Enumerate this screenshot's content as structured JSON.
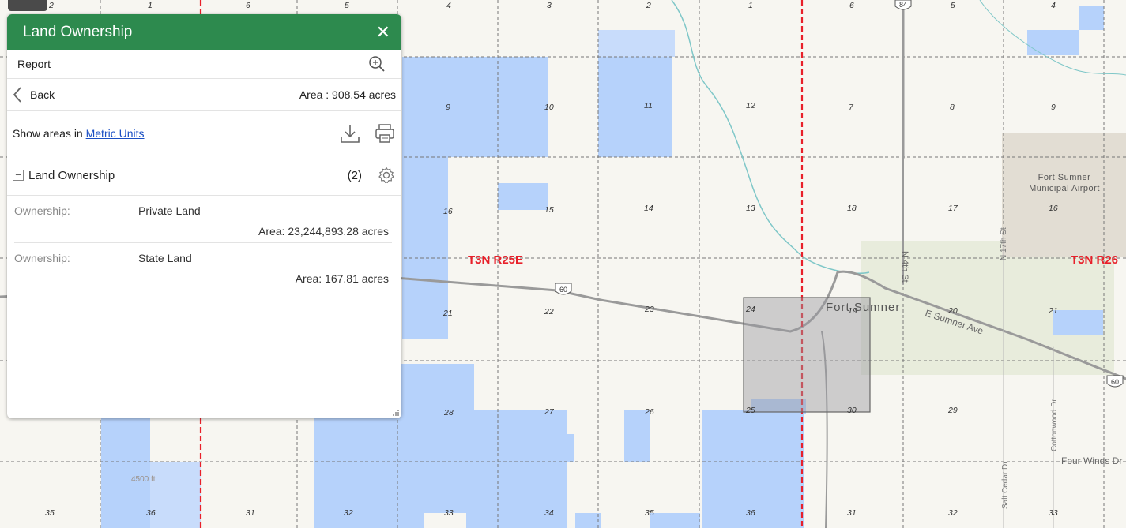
{
  "panel": {
    "title": "Land Ownership",
    "report_label": "Report",
    "back_label": "Back",
    "area_total": "Area : 908.54 acres",
    "show_areas_prefix": "Show areas in",
    "units_link": "Metric Units",
    "layer_name": "Land Ownership",
    "layer_count": "(2)",
    "results": [
      {
        "key": "Ownership:",
        "value": "Private Land",
        "area": "Area: 23,244,893.28 acres"
      },
      {
        "key": "Ownership:",
        "value": "State Land",
        "area": "Area: 167.81 acres"
      }
    ]
  },
  "map": {
    "township_labels": [
      "T3N R25E",
      "T3N R26"
    ],
    "town_name": "Fort Sumner",
    "airport_label": "Fort Sumner Municipal Airport",
    "road_labels": [
      "E Sumner Ave",
      "N 4th St",
      "N 17th St",
      "Salt Cedar Dr",
      "Cottonwood Dr",
      "Four Winds Dr"
    ],
    "highway_shields": [
      "60",
      "60",
      "84"
    ],
    "contour_label": "4500 ft",
    "section_numbers": [
      "2",
      "1",
      "6",
      "5",
      "4",
      "3",
      "2",
      "1",
      "6",
      "5",
      "4",
      "9",
      "10",
      "11",
      "12",
      "7",
      "8",
      "9",
      "16",
      "15",
      "14",
      "13",
      "18",
      "17",
      "16",
      "21",
      "22",
      "23",
      "24",
      "19",
      "20",
      "21",
      "28",
      "27",
      "26",
      "25",
      "30",
      "29",
      "35",
      "36",
      "31",
      "32",
      "33",
      "34",
      "35",
      "36",
      "31",
      "32",
      "33"
    ],
    "colors": {
      "public_land": "#b6d2fb",
      "selection": "#b9b9bf",
      "township_line": "#e8202a",
      "header": "#2d8a4e"
    }
  }
}
